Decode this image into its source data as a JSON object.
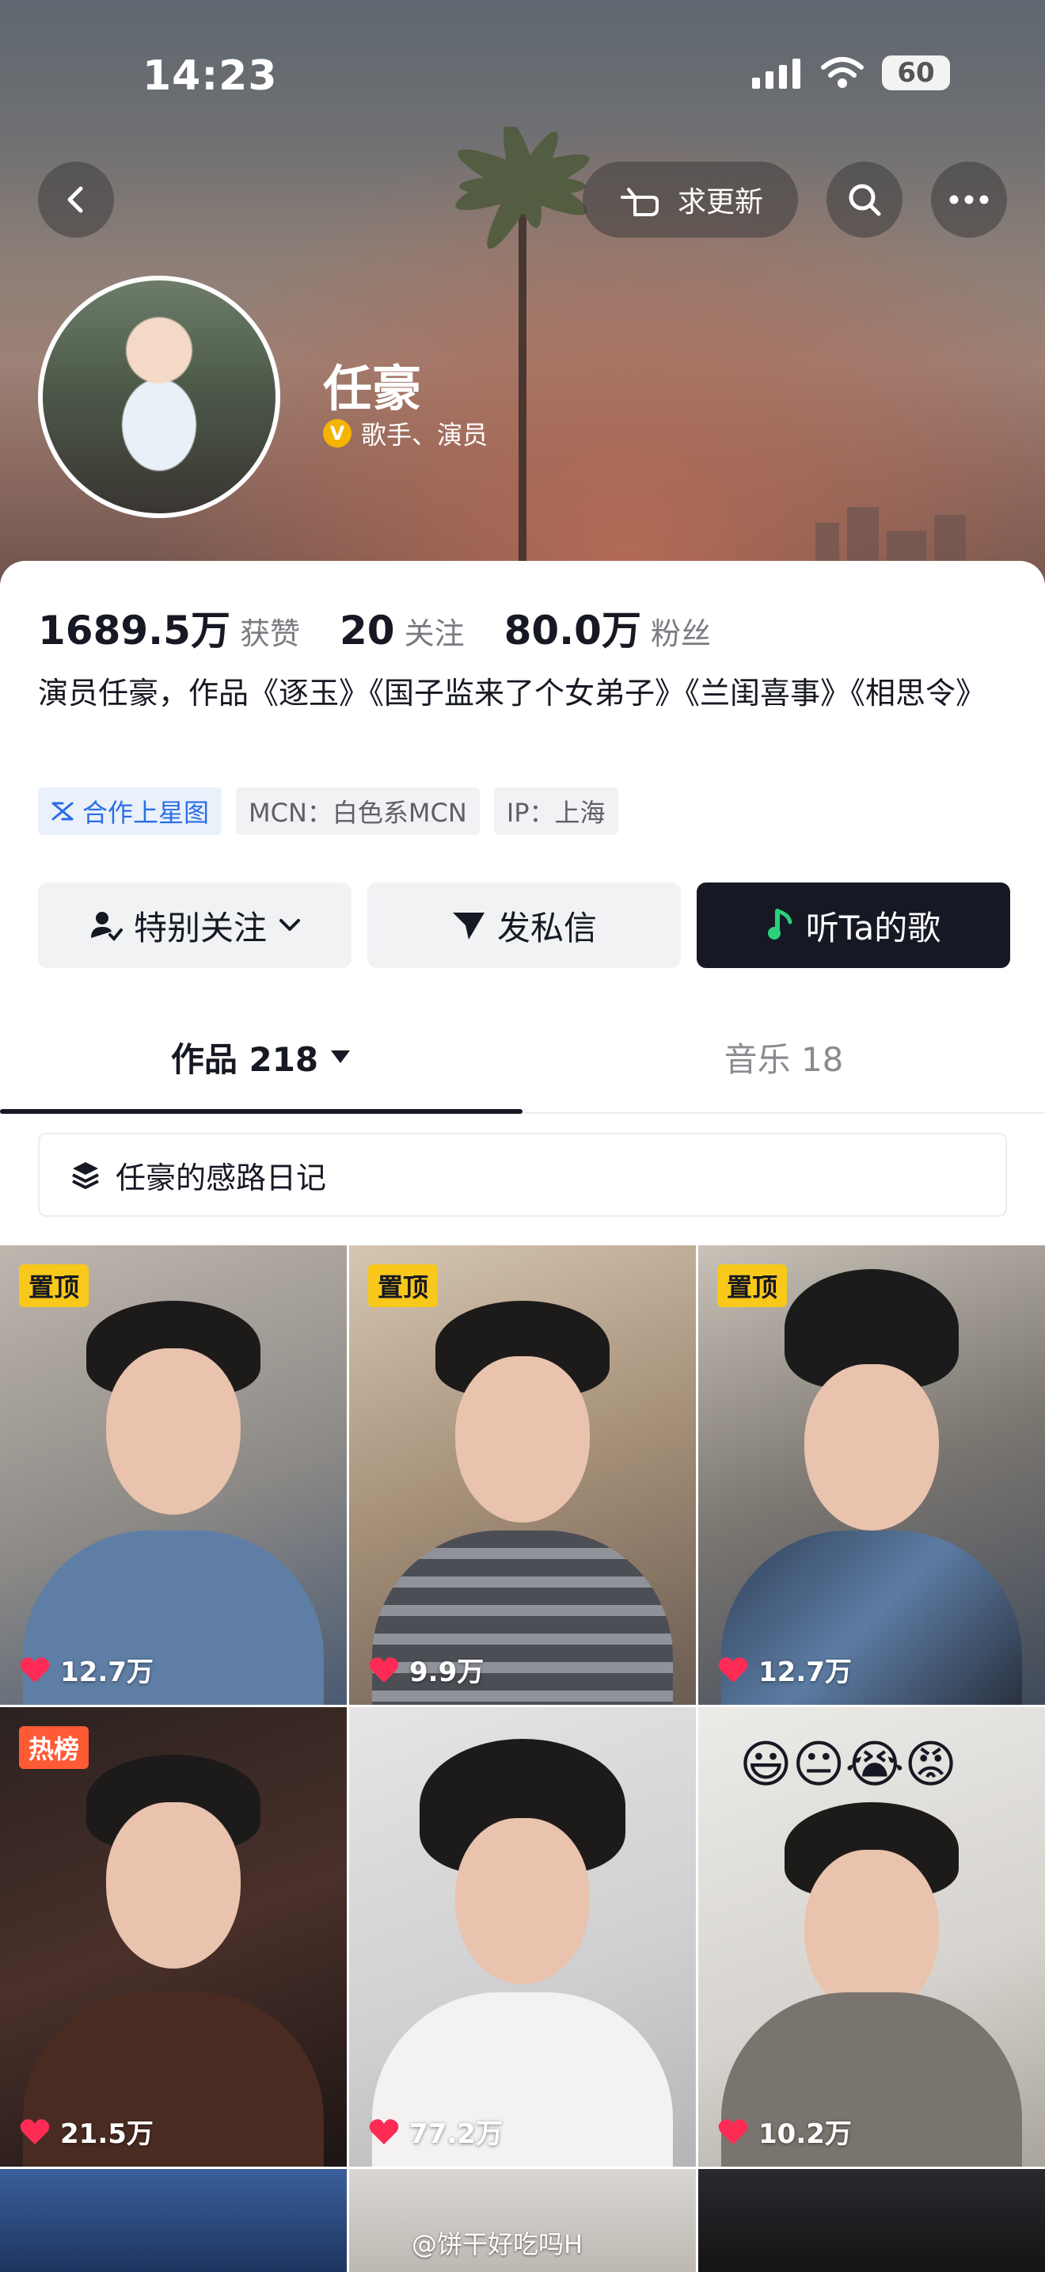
{
  "status_bar": {
    "time": "14:23",
    "battery": "60"
  },
  "header": {
    "request_update_label": "求更新"
  },
  "profile": {
    "name": "任豪",
    "tags": "歌手、演员",
    "verified_badge": "V"
  },
  "stats": [
    {
      "value": "1689.5万",
      "label": "获赞"
    },
    {
      "value": "20",
      "label": "关注"
    },
    {
      "value": "80.0万",
      "label": "粉丝"
    }
  ],
  "bio": "演员任豪，作品《逐玉》《国子监来了个女弟子》《兰闺喜事》《相思令》",
  "info_tags": {
    "cooperate": "合作上星图",
    "mcn": "MCN：白色系MCN",
    "ip": "IP：上海"
  },
  "actions": {
    "special_follow": "特别关注",
    "message": "发私信",
    "listen": "听Ta的歌"
  },
  "tabs": [
    {
      "label": "作品 218"
    },
    {
      "label": "音乐 18"
    }
  ],
  "collection": {
    "label": "任豪的感路日记"
  },
  "videos": [
    {
      "badge": "置顶",
      "likes": "12.7万"
    },
    {
      "badge": "置顶",
      "likes": "9.9万"
    },
    {
      "badge": "置顶",
      "likes": "12.7万"
    },
    {
      "badge": "热榜",
      "likes": "21.5万"
    },
    {
      "badge": "",
      "likes": "77.2万"
    },
    {
      "badge": "",
      "likes": "10.2万"
    }
  ],
  "emoji_overlay": "😃😐😭😡",
  "watermark": "@饼干好吃吗H",
  "colors": {
    "heart": "#fe2c55",
    "pin_badge": "#f8c81a",
    "hot_badge": "#ff5a36",
    "link_blue": "#2b6ee6",
    "music_icon": "#2ad17a"
  }
}
